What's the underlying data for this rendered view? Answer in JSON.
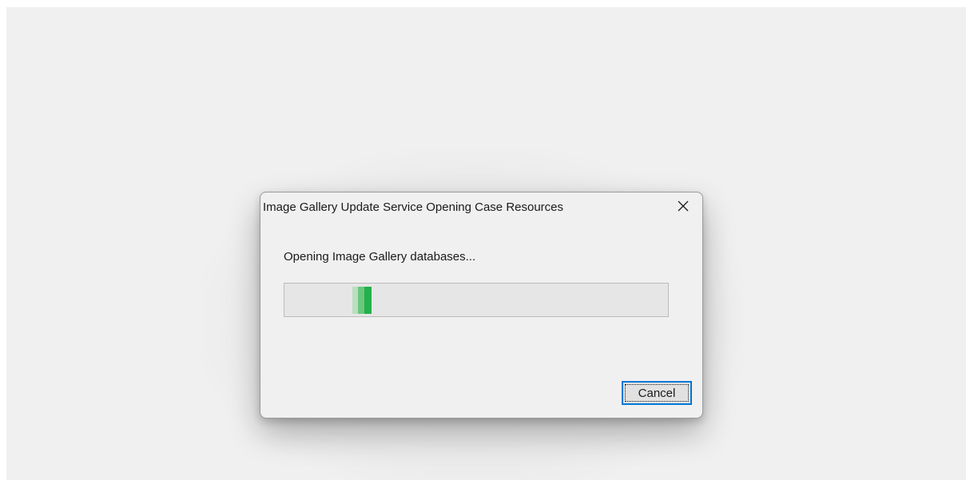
{
  "dialog": {
    "title": "Image Gallery Update Service Opening Case Resources",
    "close_icon": "close-icon",
    "message": "Opening Image Gallery databases...",
    "progress": {
      "mode": "indeterminate-marquee",
      "colors": [
        "#b9dfc0",
        "#6cc77e",
        "#22b14c"
      ]
    },
    "cancel_label": "Cancel"
  },
  "colors": {
    "window_background": "#f0f0f0",
    "progress_fill": "#22b14c",
    "focus_border": "#0078d7"
  }
}
